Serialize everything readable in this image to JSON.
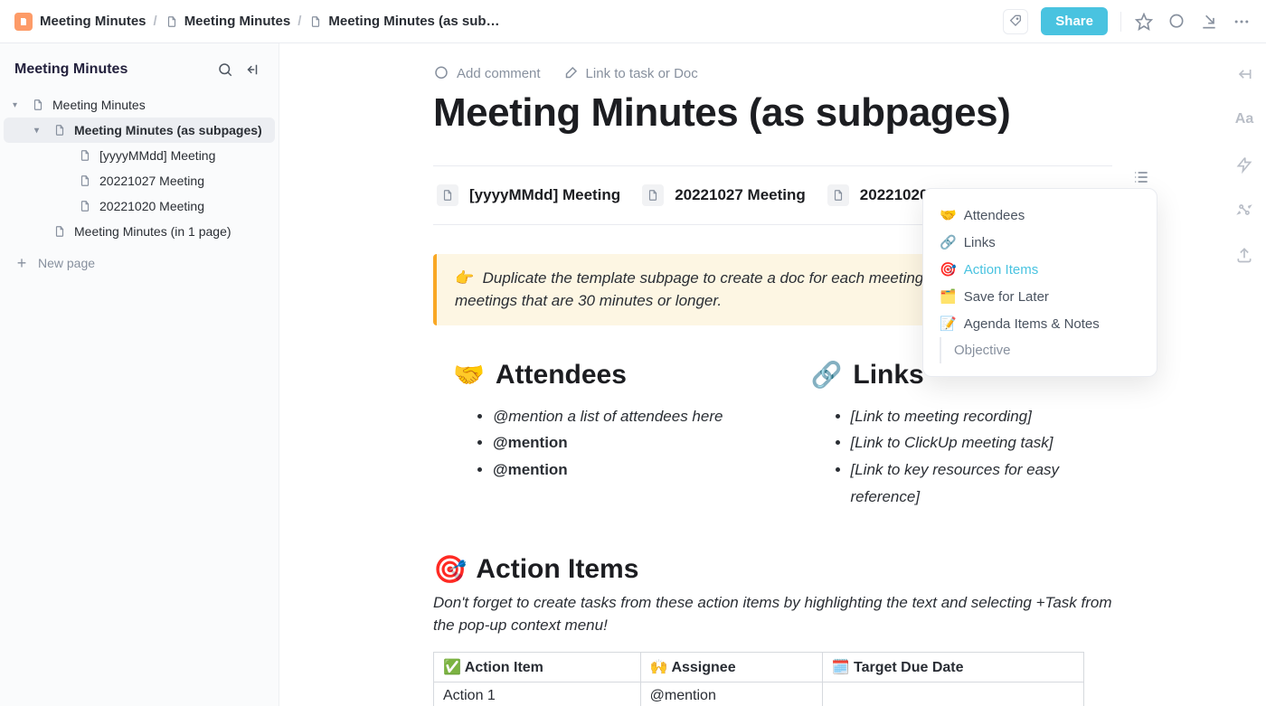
{
  "breadcrumb": {
    "root": "Meeting Minutes",
    "mid": "Meeting Minutes",
    "current": "Meeting Minutes (as sub…"
  },
  "topbar": {
    "share": "Share"
  },
  "sidebar": {
    "title": "Meeting Minutes",
    "tree": {
      "root": "Meeting Minutes",
      "subpages": "Meeting Minutes (as subpages)",
      "p1": "[yyyyMMdd] Meeting",
      "p2": "20221027 Meeting",
      "p3": "20221020 Meeting",
      "single": "Meeting Minutes (in 1 page)"
    },
    "new_page": "New page"
  },
  "editor": {
    "add_comment": "Add comment",
    "link_task": "Link to task or Doc",
    "title": "Meeting Minutes (as subpages)",
    "subpages": {
      "a": "[yyyyMMdd] Meeting",
      "b": "20221027 Meeting",
      "c": "20221020 Meet"
    },
    "callout": "Duplicate the template subpage to create a doc for each meeting. We recommend this for meetings that are 30 minutes or longer.",
    "attendees": {
      "heading": "Attendees",
      "i1": "@mention a list of attendees here",
      "i2": "@mention",
      "i3": "@mention"
    },
    "links": {
      "heading": "Links",
      "i1": "[Link to meeting recording]",
      "i2": "[Link to ClickUp meeting task]",
      "i3": "[Link to key resources for easy reference]"
    },
    "action_items": {
      "heading": "Action Items",
      "sub": "Don't forget to create tasks from these action items by highlighting the text and selecting +Task from the pop-up context menu!",
      "th1": "✅ Action Item",
      "th2": "🙌 Assignee",
      "th3": "🗓️ Target Due Date",
      "r1c1": "Action 1",
      "r1c2": "@mention",
      "r1c3": ""
    }
  },
  "toc": {
    "i1": "Attendees",
    "i2": "Links",
    "i3": "Action Items",
    "i4": "Save for Later",
    "i5": "Agenda Items & Notes",
    "i6": "Objective"
  },
  "rail": {
    "aa": "Aa"
  }
}
